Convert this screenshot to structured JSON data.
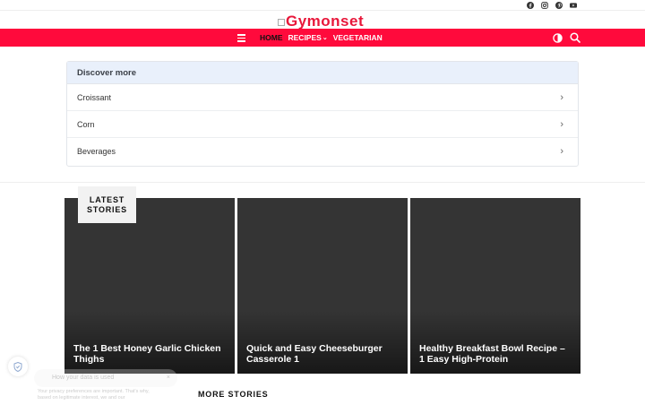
{
  "header": {
    "logo_text": "Gymonset",
    "social_icons": [
      "facebook-icon",
      "instagram-icon",
      "pinterest-icon",
      "youtube-icon"
    ]
  },
  "nav": {
    "items": [
      {
        "label": "HOME",
        "active": true
      },
      {
        "label": "RECIPES",
        "has_dropdown": true
      },
      {
        "label": "VEGETARIAN"
      }
    ],
    "accent_color": "#ff0a3c"
  },
  "discover": {
    "title": "Discover more",
    "items": [
      "Croissant",
      "Corn",
      "Beverages"
    ]
  },
  "latest": {
    "badge_line1": "LATEST",
    "badge_line2": "STORIES",
    "cards": [
      {
        "title": "The 1 Best Honey Garlic Chicken Thighs"
      },
      {
        "title": "Quick and Easy Cheeseburger Casserole 1"
      },
      {
        "title": "Healthy Breakfast Bowl Recipe – 1 Easy High-Protein"
      }
    ]
  },
  "more_stories": "MORE STORIES",
  "privacy": {
    "title": "How your data is used",
    "text": "Your privacy preferences are important. That's why, based on legitimate interest, we and our",
    "close": "×"
  }
}
